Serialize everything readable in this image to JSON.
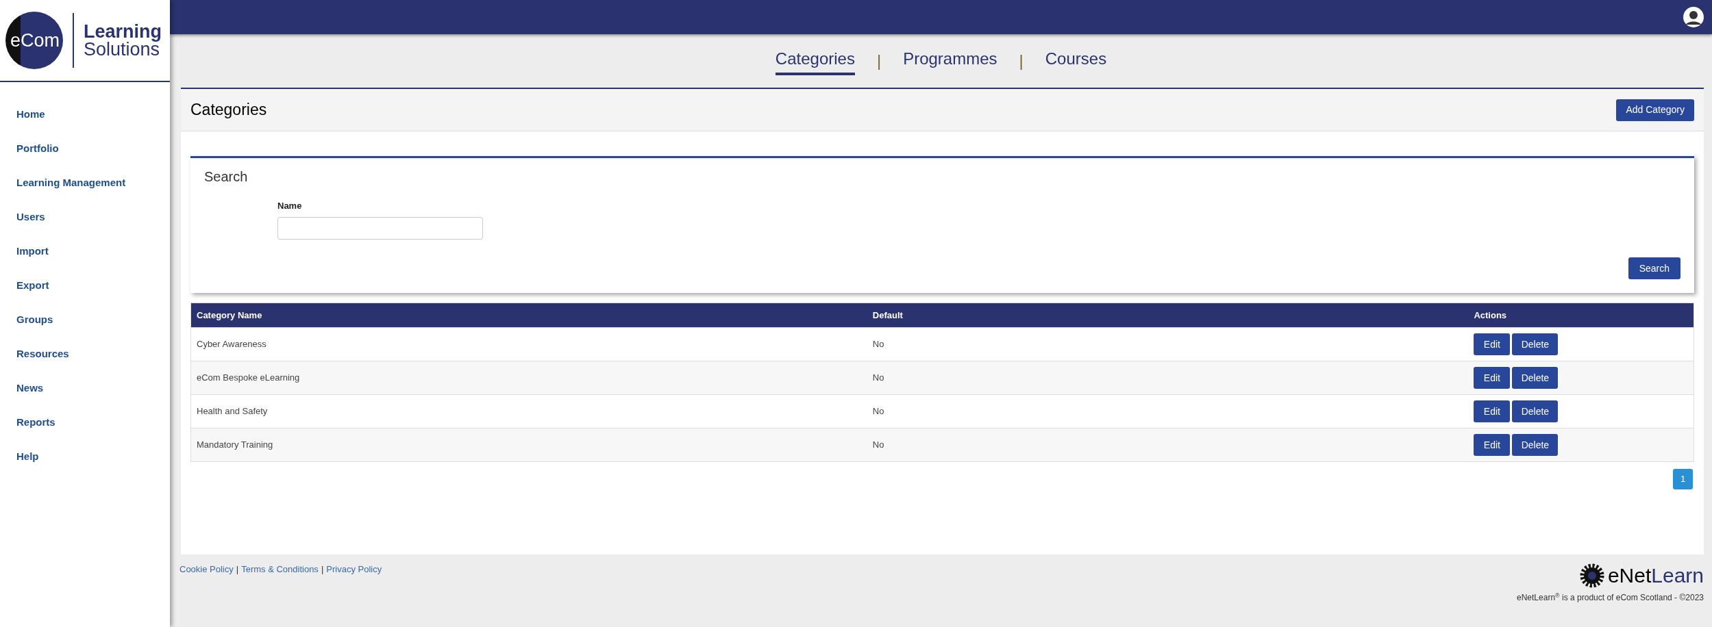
{
  "logo": {
    "mark": "eCom",
    "line1": "Learning",
    "line2": "Solutions"
  },
  "sidebar": {
    "items": [
      {
        "label": "Home"
      },
      {
        "label": "Portfolio"
      },
      {
        "label": "Learning Management"
      },
      {
        "label": "Users"
      },
      {
        "label": "Import"
      },
      {
        "label": "Export"
      },
      {
        "label": "Groups"
      },
      {
        "label": "Resources"
      },
      {
        "label": "News"
      },
      {
        "label": "Reports"
      },
      {
        "label": "Help"
      }
    ]
  },
  "tabs": [
    {
      "label": "Categories",
      "selected": true
    },
    {
      "label": "Programmes",
      "selected": false
    },
    {
      "label": "Courses",
      "selected": false
    }
  ],
  "tab_separator": "|",
  "panel": {
    "title": "Categories",
    "add_button": "Add Category"
  },
  "search": {
    "title": "Search",
    "field_label": "Name",
    "button": "Search"
  },
  "table": {
    "columns": [
      "Category Name",
      "Default",
      "Actions"
    ],
    "rows": [
      {
        "name": "Cyber Awareness",
        "default": "No",
        "actions": [
          "Edit",
          "Delete"
        ]
      },
      {
        "name": "eCom Bespoke eLearning",
        "default": "No",
        "actions": [
          "Edit",
          "Delete"
        ]
      },
      {
        "name": "Health and Safety",
        "default": "No",
        "actions": [
          "Edit",
          "Delete"
        ]
      },
      {
        "name": "Mandatory Training",
        "default": "No",
        "actions": [
          "Edit",
          "Delete"
        ]
      }
    ]
  },
  "pagination": [
    {
      "label": "1",
      "selected": true
    }
  ],
  "footer": {
    "links": [
      "Cookie Policy",
      "Terms & Conditions",
      "Privacy Policy"
    ],
    "separator": "|",
    "brand": {
      "dark": "eNet",
      "accent": "Learn"
    },
    "copyright": "eNetLearn$^{®}$ is a product of eCom Scotland - ©2023"
  }
}
